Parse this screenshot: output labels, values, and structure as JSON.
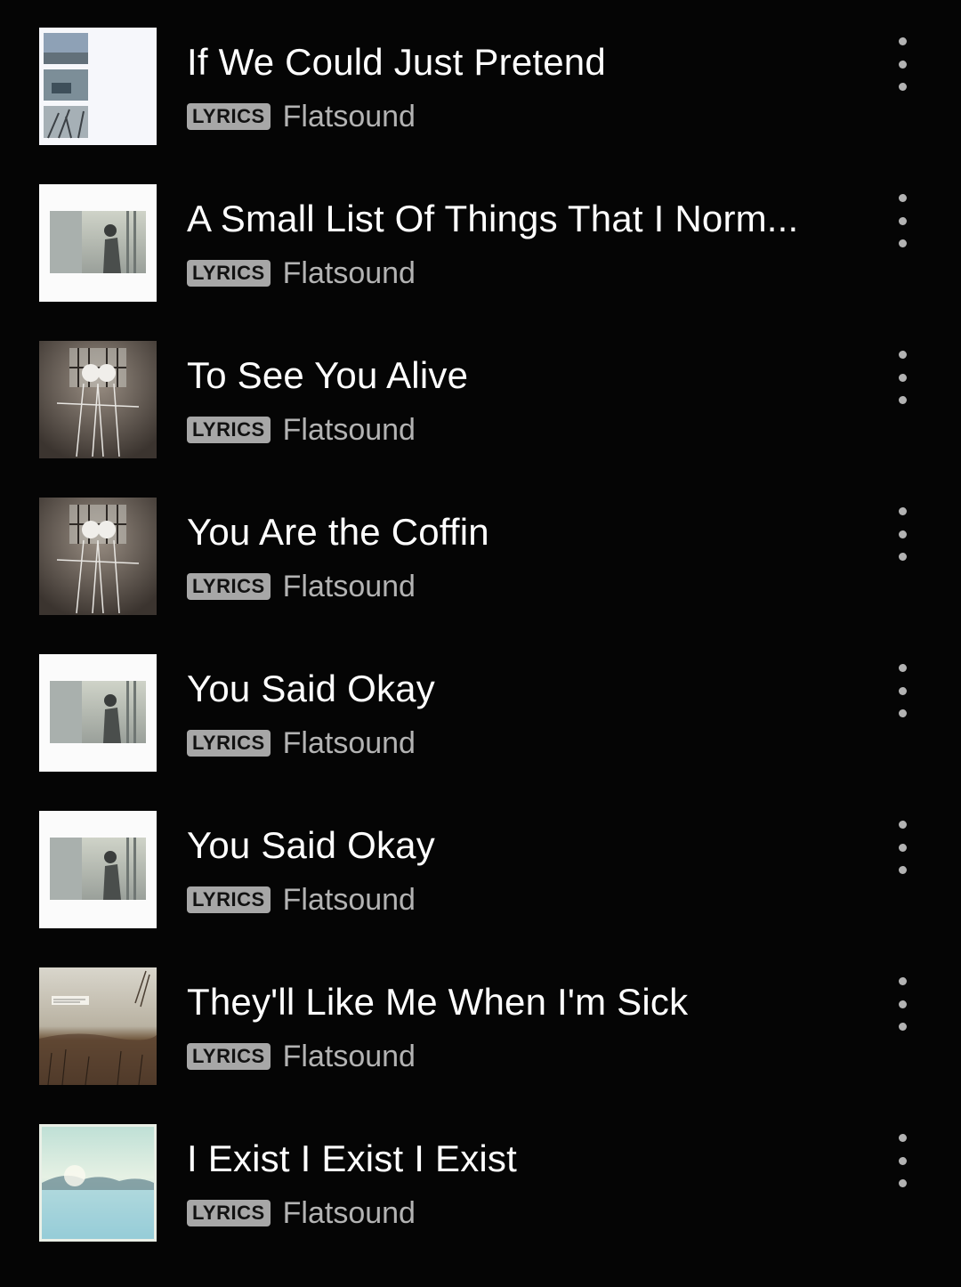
{
  "tracks": [
    {
      "title": "If We Could Just Pretend",
      "badge": "LYRICS",
      "artist": "Flatsound",
      "art_icon": "album-cover-collage"
    },
    {
      "title": "A Small List Of Things That I Norm...",
      "badge": "LYRICS",
      "artist": "Flatsound",
      "art_icon": "album-cover-boy-at-window"
    },
    {
      "title": "To See You Alive",
      "badge": "LYRICS",
      "artist": "Flatsound",
      "art_icon": "album-cover-sketched-figures"
    },
    {
      "title": "You Are the Coffin",
      "badge": "LYRICS",
      "artist": "Flatsound",
      "art_icon": "album-cover-sketched-figures"
    },
    {
      "title": "You Said Okay",
      "badge": "LYRICS",
      "artist": "Flatsound",
      "art_icon": "album-cover-boy-at-window"
    },
    {
      "title": "You Said Okay",
      "badge": "LYRICS",
      "artist": "Flatsound",
      "art_icon": "album-cover-boy-at-window"
    },
    {
      "title": "They'll Like Me When I'm Sick",
      "badge": "LYRICS",
      "artist": "Flatsound",
      "art_icon": "album-cover-field"
    },
    {
      "title": "I Exist I Exist I Exist",
      "badge": "LYRICS",
      "artist": "Flatsound",
      "art_icon": "album-cover-lake"
    }
  ],
  "more_icon": "more-vertical-icon",
  "colors": {
    "background": "#050505",
    "title": "#ffffff",
    "subtitle": "#b3b3b3",
    "badge_bg": "#a7a7a7",
    "badge_text": "#121212"
  }
}
